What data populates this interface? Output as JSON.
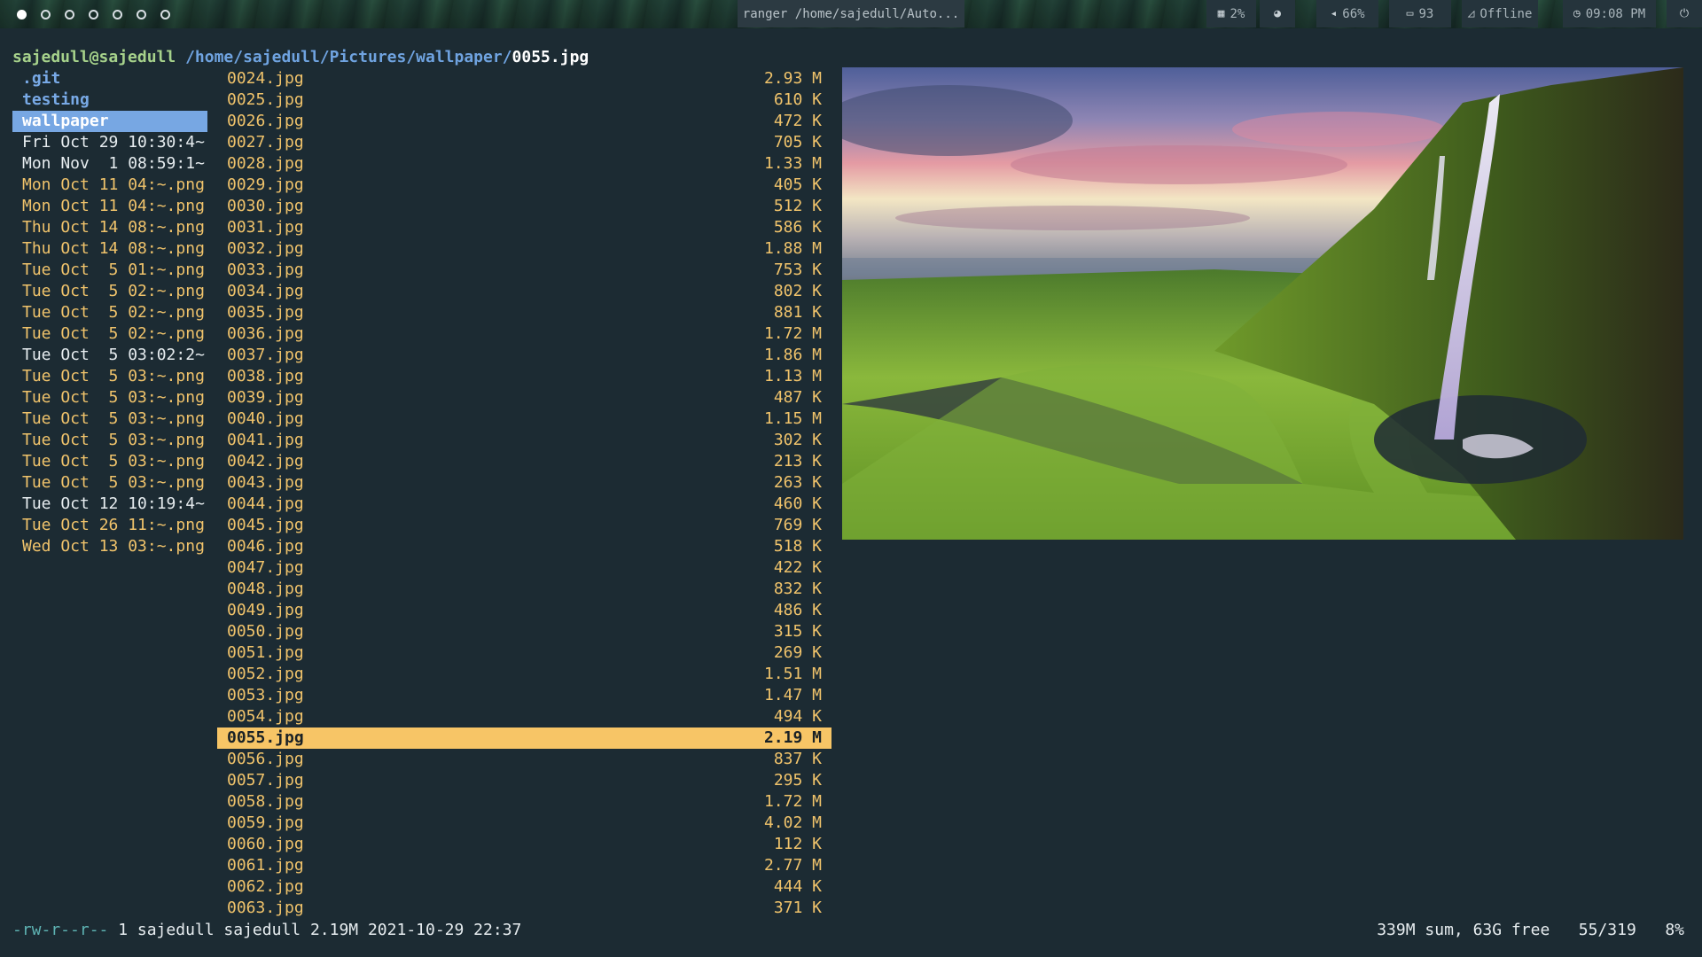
{
  "topbar": {
    "workspaces": [
      {
        "active": true
      },
      {
        "active": false
      },
      {
        "active": false
      },
      {
        "active": false
      },
      {
        "active": false
      },
      {
        "active": false
      },
      {
        "active": false
      }
    ],
    "window_title": "ranger /home/sajedull/Auto...",
    "modules": {
      "cpu": {
        "icon": "cpu-icon",
        "label": "2%"
      },
      "theme": {
        "icon": "palette-icon"
      },
      "volume": {
        "icon": "speaker-icon",
        "label": "66%"
      },
      "battery": {
        "icon": "battery-icon",
        "label": "93"
      },
      "network": {
        "icon": "wifi-off-icon",
        "label": "Offline"
      },
      "clock": {
        "icon": "clock-icon",
        "label": "09:08 PM"
      },
      "power": {
        "icon": "power-icon"
      }
    }
  },
  "ranger": {
    "path": {
      "user_host": "sajedull@sajedull",
      "dir": "/home/sajedull/Pictures/wallpaper/",
      "file": "0055.jpg"
    },
    "parent_entries": [
      {
        "name": ".git",
        "kind": "dir"
      },
      {
        "name": "testing",
        "kind": "dir"
      },
      {
        "name": "wallpaper",
        "kind": "dir",
        "selected": true
      },
      {
        "name": "Fri Oct 29 10:30:4~",
        "kind": "plain"
      },
      {
        "name": "Mon Nov  1 08:59:1~",
        "kind": "plain"
      },
      {
        "name": "Mon Oct 11 04:~.png",
        "kind": "image"
      },
      {
        "name": "Mon Oct 11 04:~.png",
        "kind": "image"
      },
      {
        "name": "Thu Oct 14 08:~.png",
        "kind": "image"
      },
      {
        "name": "Thu Oct 14 08:~.png",
        "kind": "image"
      },
      {
        "name": "Tue Oct  5 01:~.png",
        "kind": "image"
      },
      {
        "name": "Tue Oct  5 02:~.png",
        "kind": "image"
      },
      {
        "name": "Tue Oct  5 02:~.png",
        "kind": "image"
      },
      {
        "name": "Tue Oct  5 02:~.png",
        "kind": "image"
      },
      {
        "name": "Tue Oct  5 03:02:2~",
        "kind": "plain"
      },
      {
        "name": "Tue Oct  5 03:~.png",
        "kind": "image"
      },
      {
        "name": "Tue Oct  5 03:~.png",
        "kind": "image"
      },
      {
        "name": "Tue Oct  5 03:~.png",
        "kind": "image"
      },
      {
        "name": "Tue Oct  5 03:~.png",
        "kind": "image"
      },
      {
        "name": "Tue Oct  5 03:~.png",
        "kind": "image"
      },
      {
        "name": "Tue Oct  5 03:~.png",
        "kind": "image"
      },
      {
        "name": "Tue Oct 12 10:19:4~",
        "kind": "plain"
      },
      {
        "name": "Tue Oct 26 11:~.png",
        "kind": "image"
      },
      {
        "name": "Wed Oct 13 03:~.png",
        "kind": "image"
      }
    ],
    "files": [
      {
        "name": "0024.jpg",
        "size": "2.93 M"
      },
      {
        "name": "0025.jpg",
        "size": "610 K"
      },
      {
        "name": "0026.jpg",
        "size": "472 K"
      },
      {
        "name": "0027.jpg",
        "size": "705 K"
      },
      {
        "name": "0028.jpg",
        "size": "1.33 M"
      },
      {
        "name": "0029.jpg",
        "size": "405 K"
      },
      {
        "name": "0030.jpg",
        "size": "512 K"
      },
      {
        "name": "0031.jpg",
        "size": "586 K"
      },
      {
        "name": "0032.jpg",
        "size": "1.88 M"
      },
      {
        "name": "0033.jpg",
        "size": "753 K"
      },
      {
        "name": "0034.jpg",
        "size": "802 K"
      },
      {
        "name": "0035.jpg",
        "size": "881 K"
      },
      {
        "name": "0036.jpg",
        "size": "1.72 M"
      },
      {
        "name": "0037.jpg",
        "size": "1.86 M"
      },
      {
        "name": "0038.jpg",
        "size": "1.13 M"
      },
      {
        "name": "0039.jpg",
        "size": "487 K"
      },
      {
        "name": "0040.jpg",
        "size": "1.15 M"
      },
      {
        "name": "0041.jpg",
        "size": "302 K"
      },
      {
        "name": "0042.jpg",
        "size": "213 K"
      },
      {
        "name": "0043.jpg",
        "size": "263 K"
      },
      {
        "name": "0044.jpg",
        "size": "460 K"
      },
      {
        "name": "0045.jpg",
        "size": "769 K"
      },
      {
        "name": "0046.jpg",
        "size": "518 K"
      },
      {
        "name": "0047.jpg",
        "size": "422 K"
      },
      {
        "name": "0048.jpg",
        "size": "832 K"
      },
      {
        "name": "0049.jpg",
        "size": "486 K"
      },
      {
        "name": "0050.jpg",
        "size": "315 K"
      },
      {
        "name": "0051.jpg",
        "size": "269 K"
      },
      {
        "name": "0052.jpg",
        "size": "1.51 M"
      },
      {
        "name": "0053.jpg",
        "size": "1.47 M"
      },
      {
        "name": "0054.jpg",
        "size": "494 K"
      },
      {
        "name": "0055.jpg",
        "size": "2.19 M",
        "selected": true
      },
      {
        "name": "0056.jpg",
        "size": "837 K"
      },
      {
        "name": "0057.jpg",
        "size": "295 K"
      },
      {
        "name": "0058.jpg",
        "size": "1.72 M"
      },
      {
        "name": "0059.jpg",
        "size": "4.02 M"
      },
      {
        "name": "0060.jpg",
        "size": "112 K"
      },
      {
        "name": "0061.jpg",
        "size": "2.77 M"
      },
      {
        "name": "0062.jpg",
        "size": "444 K"
      },
      {
        "name": "0063.jpg",
        "size": "371 K"
      }
    ],
    "preview": {
      "subject": "waterfall-landscape"
    },
    "status": {
      "perms": "-rw-r--r--",
      "info": " 1 sajedull sajedull 2.19M 2021-10-29 22:37",
      "right": "339M sum, 63G free   55/319   8%"
    }
  },
  "colors": {
    "background": "#1c2b33",
    "file_color": "#f0c36b",
    "dir_color": "#78a9e6",
    "selected_file_bg": "#f7c566",
    "selected_dir_bg": "#77a7e3",
    "user_host": "#a6d28b",
    "perms": "#5eb3b3"
  }
}
